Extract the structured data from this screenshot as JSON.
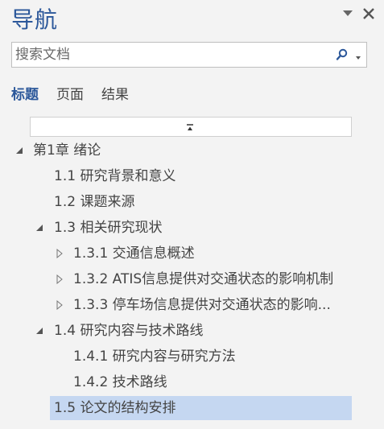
{
  "pane": {
    "title": "导航"
  },
  "search": {
    "placeholder": "搜索文档"
  },
  "tabs": [
    {
      "label": "标题",
      "active": true
    },
    {
      "label": "页面",
      "active": false
    },
    {
      "label": "结果",
      "active": false
    }
  ],
  "tree": [
    {
      "label": "第1章 绪论",
      "level": 0,
      "arrow": "expanded",
      "selected": false
    },
    {
      "label": "1.1 研究背景和意义",
      "level": 1,
      "arrow": "none",
      "selected": false
    },
    {
      "label": "1.2 课题来源",
      "level": 1,
      "arrow": "none",
      "selected": false
    },
    {
      "label": "1.3 相关研究现状",
      "level": 1,
      "arrow": "expanded",
      "selected": false
    },
    {
      "label": "1.3.1 交通信息概述",
      "level": 2,
      "arrow": "collapsed",
      "selected": false
    },
    {
      "label": "1.3.2 ATIS信息提供对交通状态的影响机制",
      "level": 2,
      "arrow": "collapsed",
      "selected": false
    },
    {
      "label": "1.3.3 停车场信息提供对交通状态的影响...",
      "level": 2,
      "arrow": "collapsed",
      "selected": false
    },
    {
      "label": "1.4 研究内容与技术路线",
      "level": 1,
      "arrow": "expanded",
      "selected": false
    },
    {
      "label": "1.4.1 研究内容与研究方法",
      "level": 2,
      "arrow": "none",
      "selected": false
    },
    {
      "label": "1.4.2 技术路线",
      "level": 2,
      "arrow": "none",
      "selected": false
    },
    {
      "label": "1.5 论文的结构安排",
      "level": 1,
      "arrow": "none",
      "selected": true
    }
  ],
  "colors": {
    "accent": "#2b579a",
    "selected_bg": "#c5d7f1",
    "pane_bg": "#f3f3f3"
  }
}
